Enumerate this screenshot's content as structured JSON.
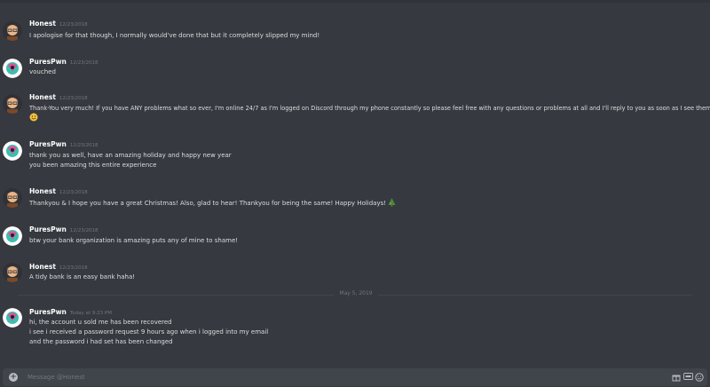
{
  "messages": [
    {
      "author": "Honest",
      "time": "12/23/2018",
      "lines": [
        "I apologise for that though, I normally would've done that but it completely slipped my mind!"
      ]
    },
    {
      "author": "PuresPwn",
      "time": "12/23/2018",
      "lines": [
        "vouched"
      ]
    },
    {
      "author": "Honest",
      "time": "12/23/2018",
      "lines": [
        "Thank-You very much! If you have ANY problems what so ever, I'm online 24/7 as I'm logged on Discord through my phone constantly so please feel free with any questions or problems at all and I'll reply to you as soon as I see them!"
      ]
    },
    {
      "author": "PuresPwn",
      "time": "12/23/2018",
      "lines": [
        "thank you as well, have an amazing holiday and happy new year",
        "you been amazing this entire experience"
      ]
    },
    {
      "author": "Honest",
      "time": "12/23/2018",
      "lines": [
        "Thankyou & I hope you have a great Christmas! Also, glad to hear! Thankyou for being the same! Happy Holidays!"
      ]
    },
    {
      "author": "PuresPwn",
      "time": "12/23/2018",
      "lines": [
        "btw your bank organization is amazing puts any of mine to shame!"
      ]
    },
    {
      "author": "Honest",
      "time": "12/23/2018",
      "lines": [
        "A tidy bank is an easy bank haha!"
      ]
    },
    {
      "author": "PuresPwn",
      "time": "Today at 9:23 PM",
      "lines": [
        "hi, the account u sold me has been recovered",
        "i see i received a password request 9 hours ago when i logged into my email",
        "and the password i had set has  been changed"
      ]
    }
  ],
  "divider": {
    "label": "May 5, 2019"
  },
  "composer": {
    "placeholder": "Message @Honest"
  },
  "colors": {
    "background": "#36393f",
    "composer": "#40444b",
    "author": "#ffffff",
    "text": "#dcddde",
    "muted": "#72767d"
  }
}
